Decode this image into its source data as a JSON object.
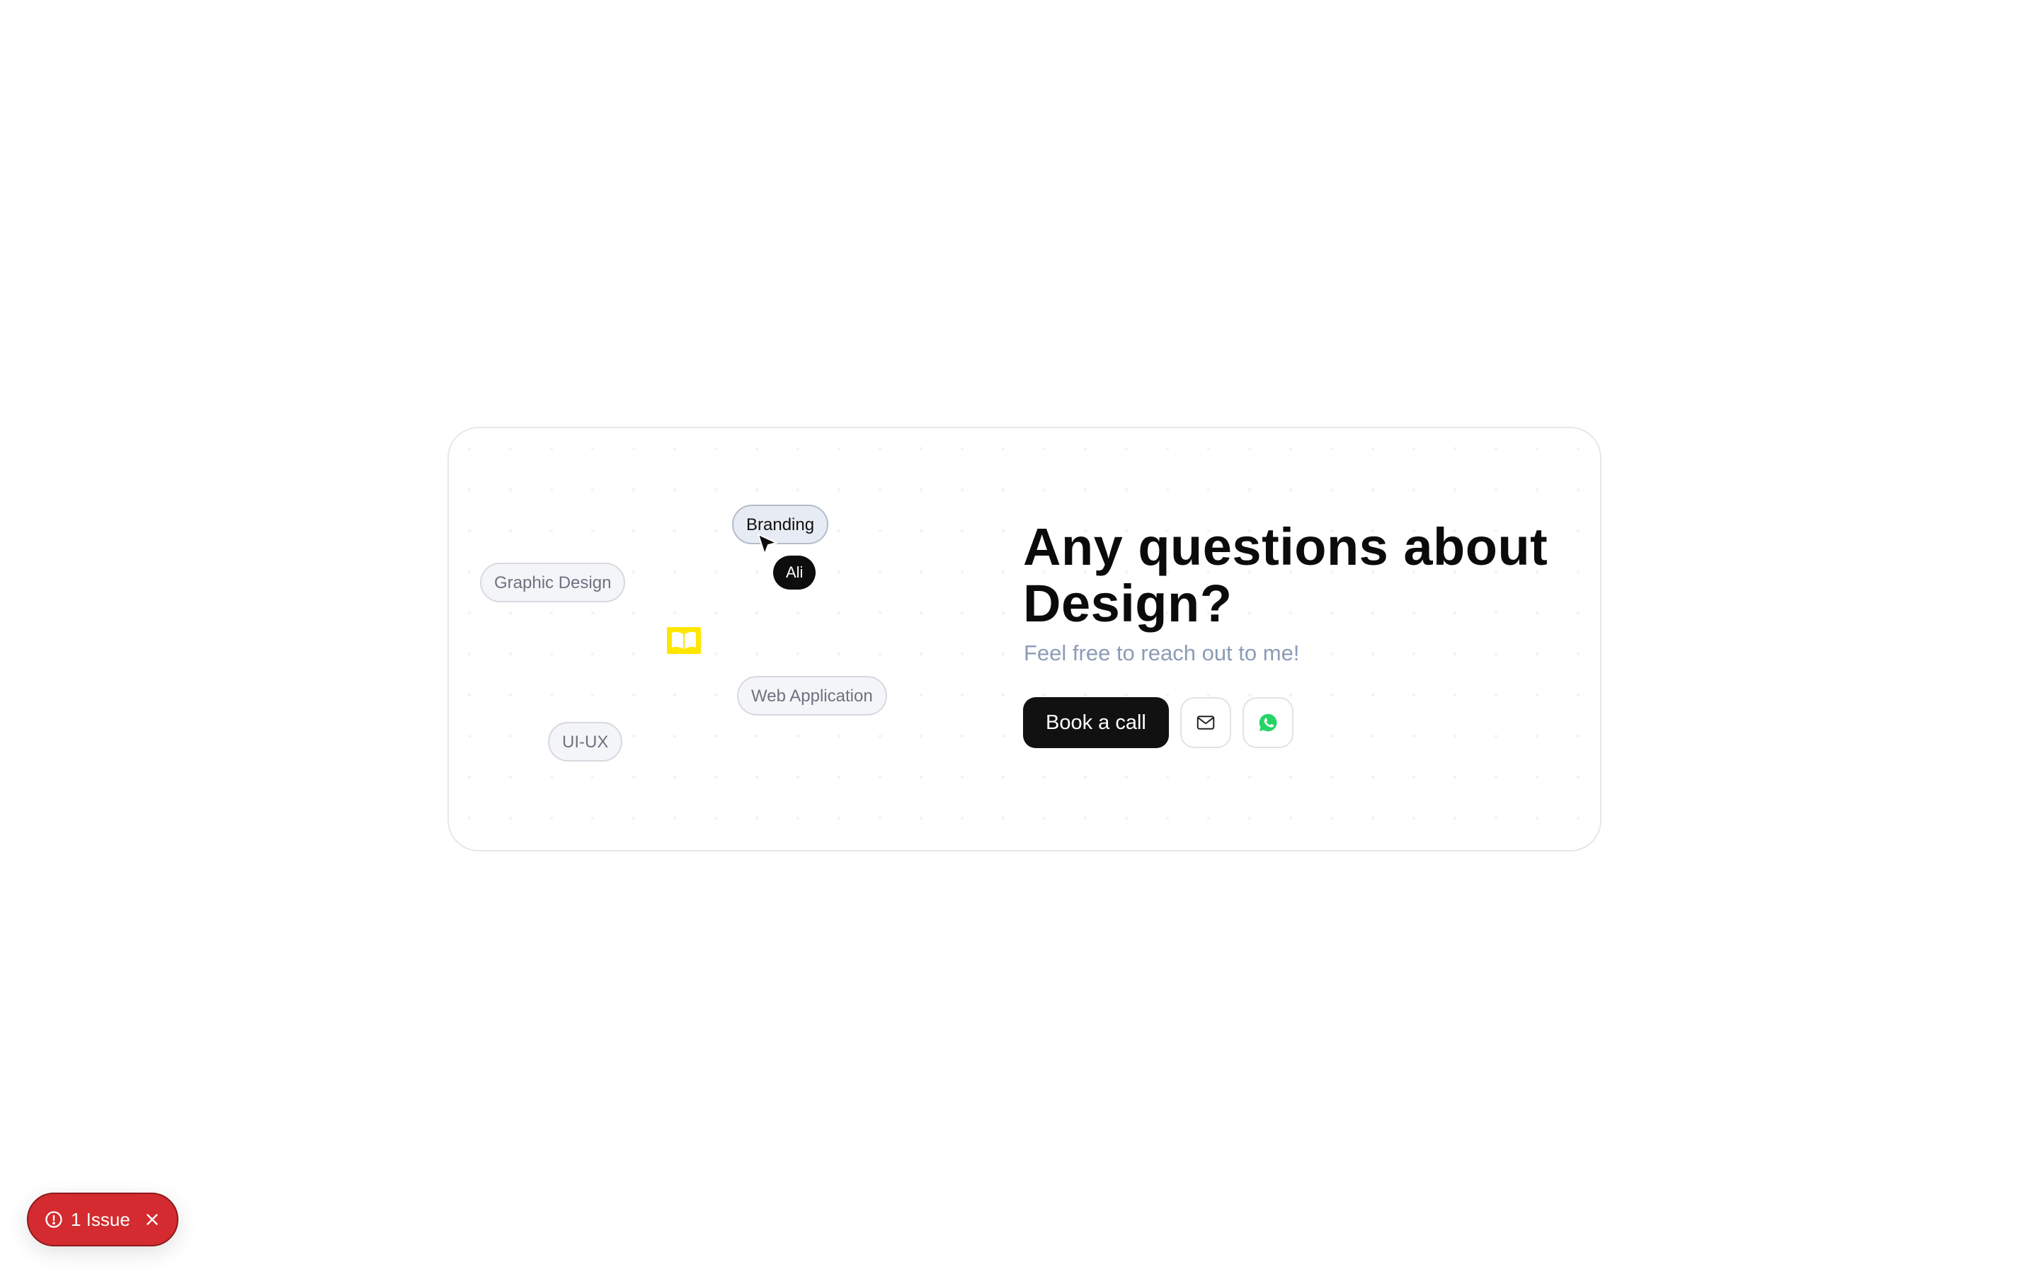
{
  "card": {
    "tags": [
      {
        "label": "Graphic Design"
      },
      {
        "label": "Branding"
      },
      {
        "label": "Web Application"
      },
      {
        "label": "UI-UX"
      }
    ],
    "cursor_name": "Ali",
    "heading": "Any questions about Design?",
    "subtext": "Feel free to reach out to me!",
    "book_button": "Book a call",
    "email_icon": "mail-icon",
    "whatsapp_icon": "whatsapp-icon",
    "decor_icon": "book-open-icon"
  },
  "issue_badge": {
    "label": "1 Issue",
    "icon": "alert-circle-icon",
    "close_icon": "close-icon"
  },
  "colors": {
    "heading": "#0b0b0b",
    "subtext": "#8c9cb6",
    "button_dark": "#111111",
    "issue_red": "#d32b2f",
    "whatsapp_green": "#25d366",
    "decor_yellow": "#ffe600"
  }
}
